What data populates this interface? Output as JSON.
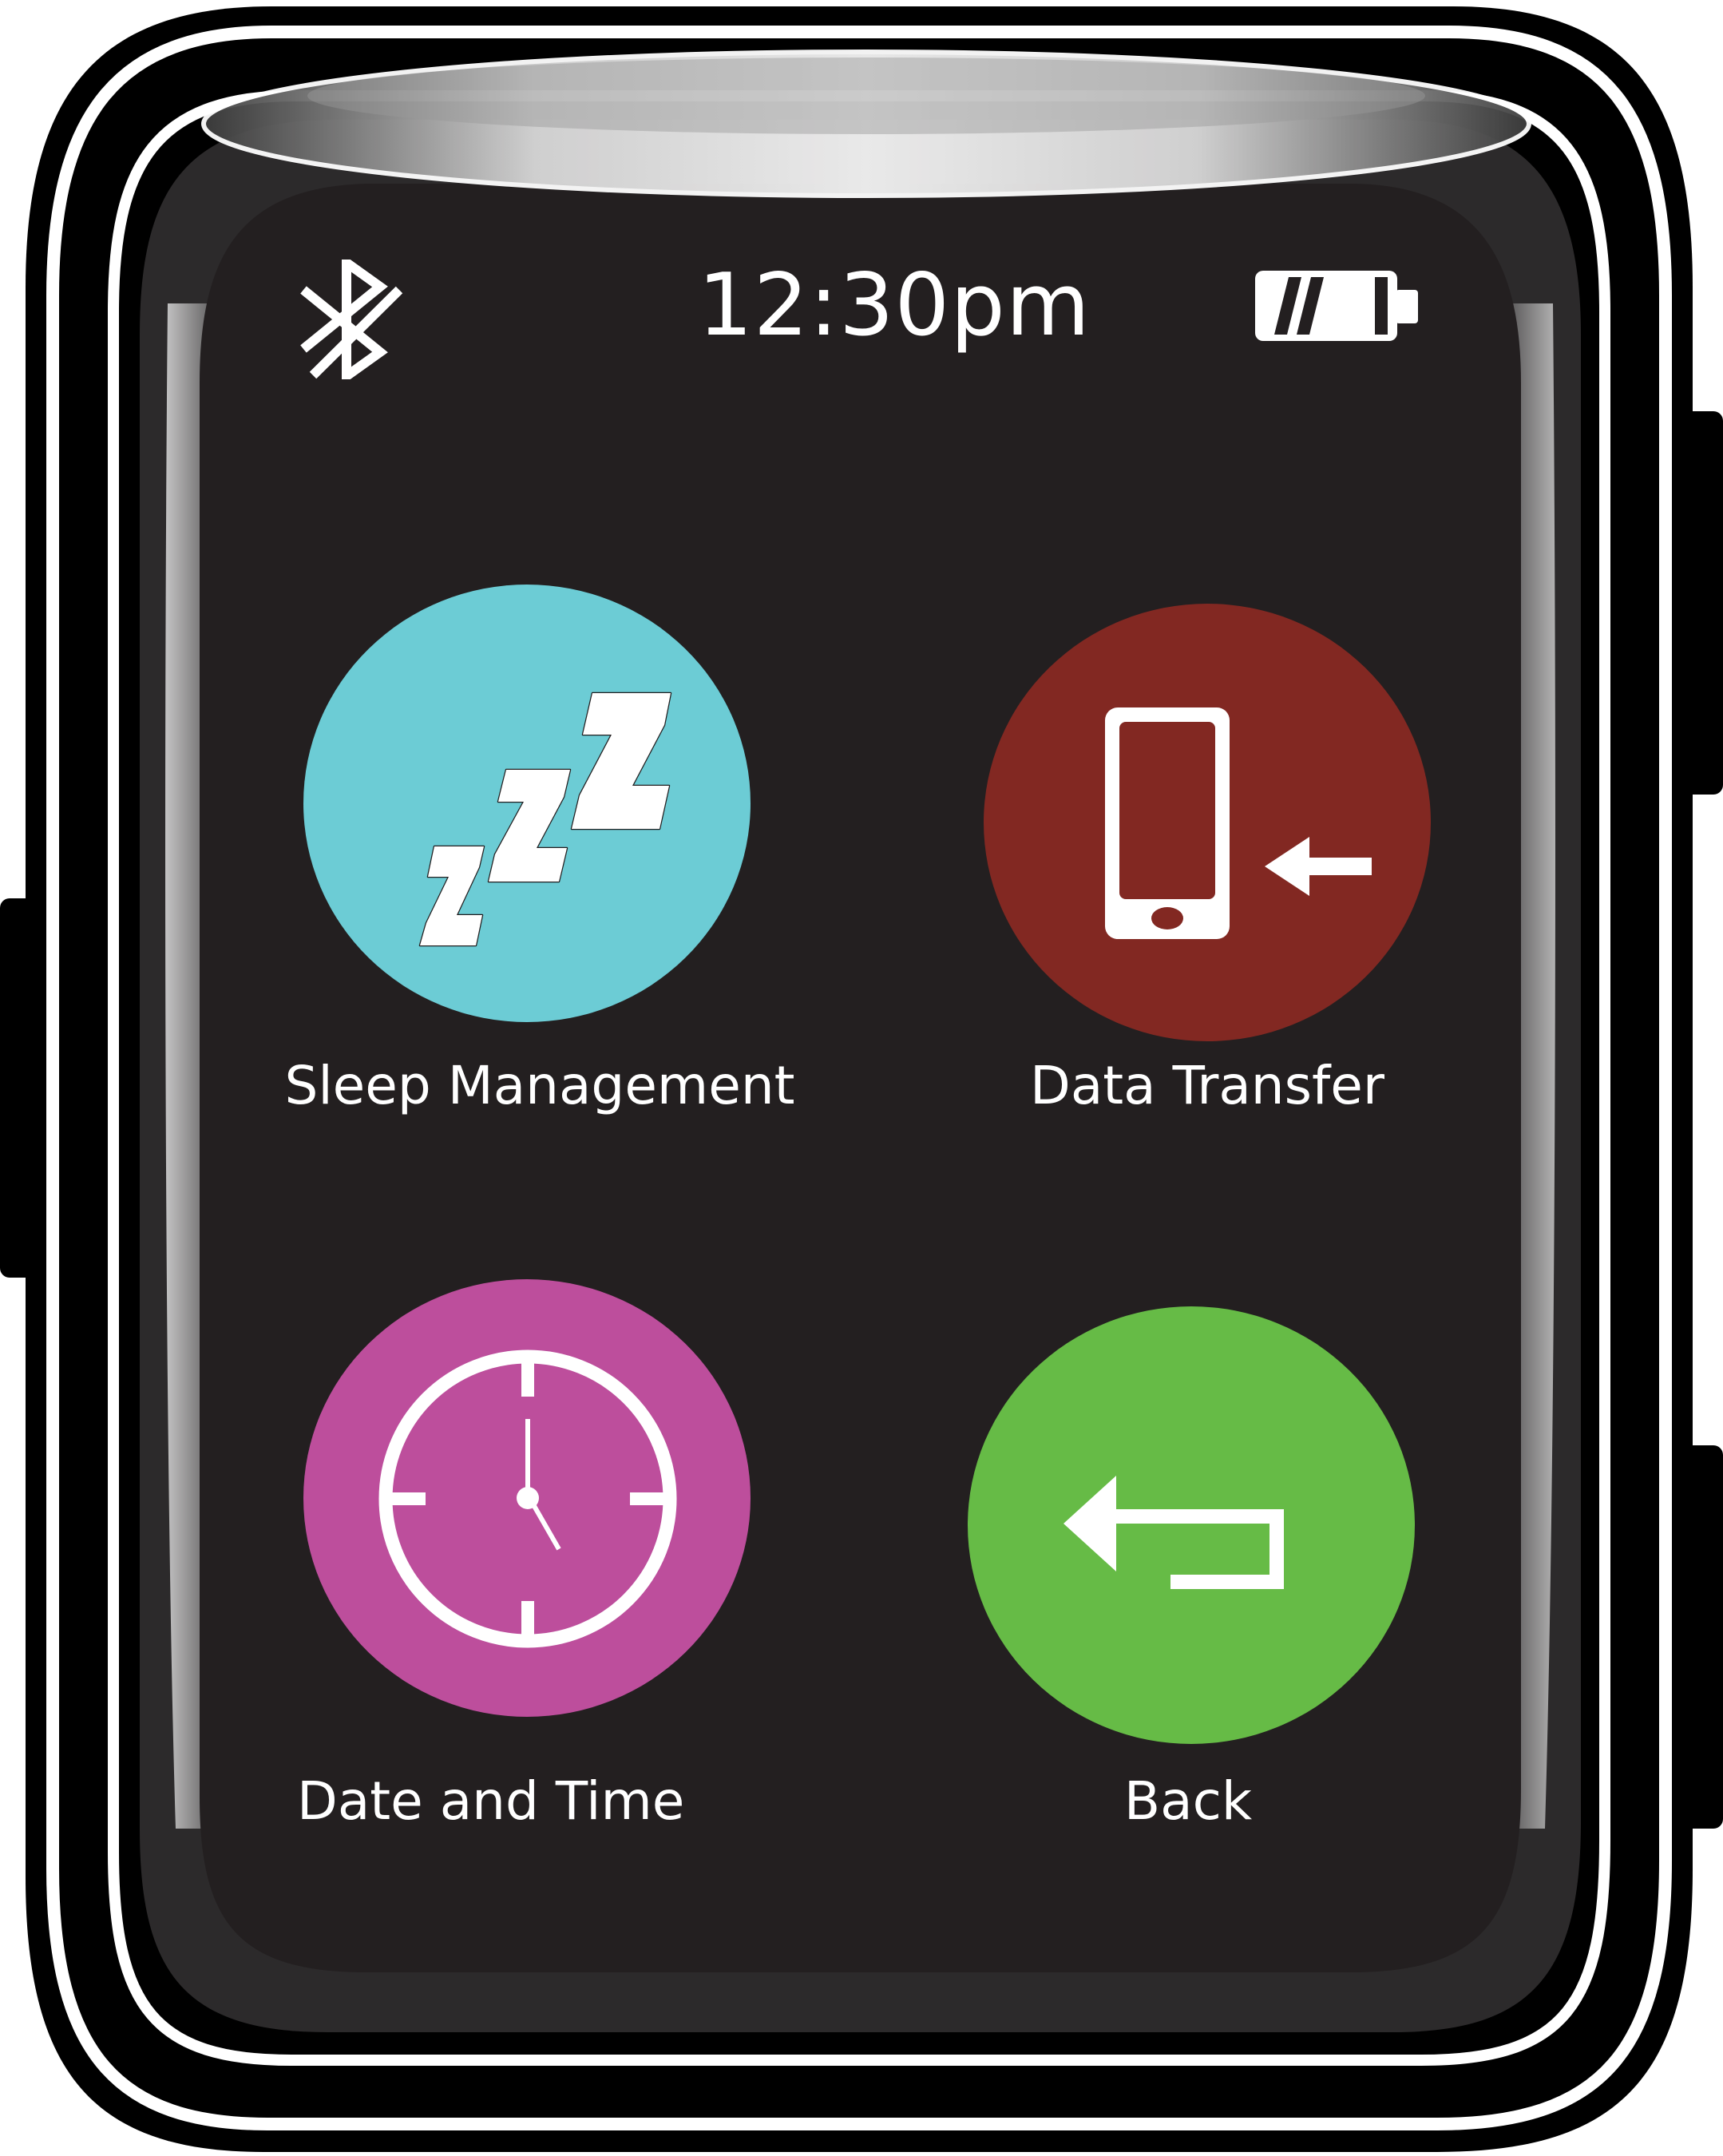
{
  "status_bar": {
    "time": "12:30pm",
    "left_icon": "bluetooth-icon",
    "right_icon": "battery-icon",
    "battery_level": 0.66
  },
  "apps": [
    {
      "label": "Sleep Management",
      "icon": "sleep-zzz-icon",
      "color": "#6cccd5"
    },
    {
      "label": "Data Transfer",
      "icon": "phone-transfer-icon",
      "color": "#822822"
    },
    {
      "label": "Date and Time",
      "icon": "clock-icon",
      "color": "#bd4e9c"
    },
    {
      "label": "Back",
      "icon": "back-arrow-icon",
      "color": "#66bb46"
    }
  ],
  "colors": {
    "screen": "#231f20",
    "bezel": "#000000",
    "icon_foreground": "#ffffff"
  }
}
